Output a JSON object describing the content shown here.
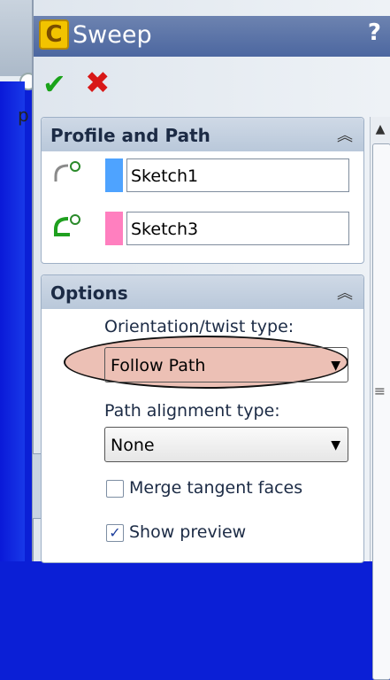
{
  "window": {
    "title": "Sweep",
    "help_label": "?"
  },
  "actions": {
    "ok_icon": "check-icon",
    "cancel_icon": "close-icon"
  },
  "profile_and_path": {
    "title": "Profile and Path",
    "profile": {
      "value": "Sketch1",
      "swatch_color": "#4ea3ff"
    },
    "path": {
      "value": "Sketch3",
      "swatch_color": "#ff7fbf"
    }
  },
  "options": {
    "title": "Options",
    "orientation_label": "Orientation/twist type:",
    "orientation_value": "Follow Path",
    "path_alignment_label": "Path alignment type:",
    "path_alignment_value": "None",
    "merge_tangent_label": "Merge tangent faces",
    "merge_tangent_checked": false,
    "show_preview_label": "Show preview",
    "show_preview_checked": true
  },
  "background": {
    "text_fragment": "p"
  },
  "colors": {
    "title_bar": "#4c67a0",
    "highlight": "#dc8c78"
  }
}
